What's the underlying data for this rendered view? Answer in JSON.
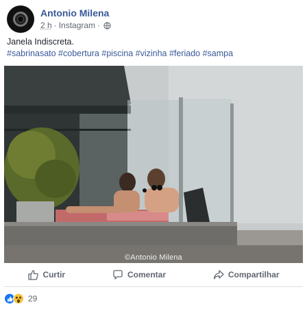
{
  "post": {
    "author": "Antonio Milena",
    "time": "2 h",
    "separator": "·",
    "source": "Instagram",
    "privacy_icon": "globe-icon",
    "caption": "Janela Indiscreta.",
    "hashtags": "#sabrinasato #cobertura #piscina #vizinha #feriado #sampa",
    "photo_watermark": "©Antonio Milena"
  },
  "actions": {
    "like_label": "Curtir",
    "comment_label": "Comentar",
    "share_label": "Compartilhar"
  },
  "reactions": {
    "icons": [
      "like-reaction-icon",
      "wow-reaction-icon"
    ],
    "count": "29"
  },
  "colors": {
    "link": "#385898",
    "secondary_text": "#606770",
    "like_blue": "#1877f2",
    "wow_yellow": "#f7c33b"
  }
}
